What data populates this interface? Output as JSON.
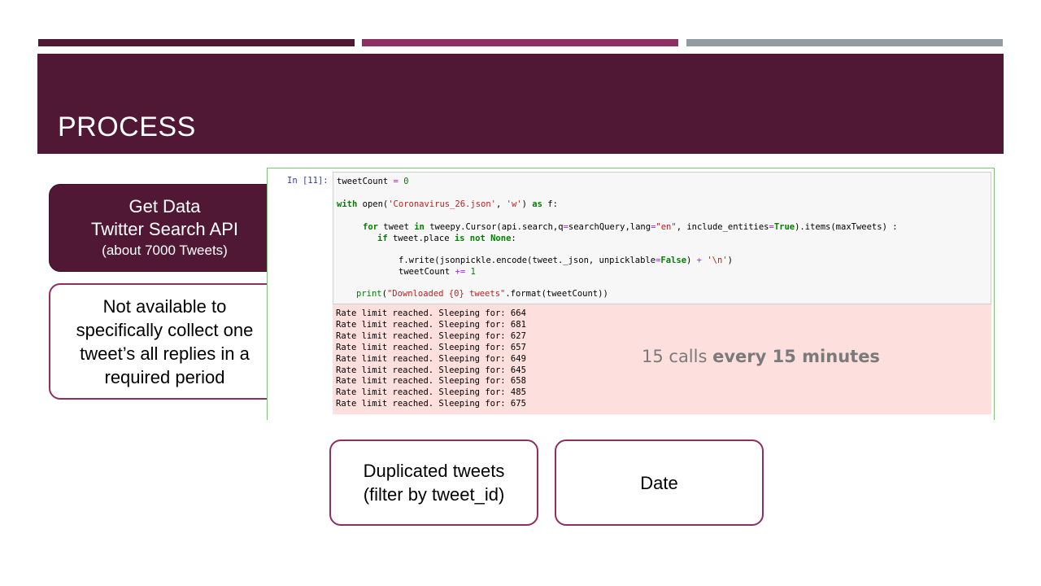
{
  "slide": {
    "title": "PROCESS",
    "colors": {
      "dark": "#511835",
      "mid": "#8e2e62",
      "grey": "#949ca3",
      "output_bg": "#fddfdd"
    }
  },
  "boxes": {
    "get_data": {
      "line1": "Get Data",
      "line2": "Twitter Search API",
      "line3": "(about 7000 Tweets)"
    },
    "not_available": {
      "line1": "Not available to",
      "line2": "specifically collect one",
      "line3": "tweet’s all  replies in a",
      "line4": "required period"
    },
    "duplicated": {
      "line1": "Duplicated tweets",
      "line2": "(filter by tweet_id)"
    },
    "date": {
      "line1": "Date"
    }
  },
  "notebook": {
    "prompt": "In [11]:",
    "code": {
      "l1_var": "tweetCount",
      "l1_op": " = ",
      "l1_num": "0",
      "l2_kw1": "with",
      "l2_a": " open(",
      "l2_str1": "'Coronavirus_26.json'",
      "l2_b": ", ",
      "l2_str2": "'w'",
      "l2_c": ") ",
      "l2_kw2": "as",
      "l2_d": " f:",
      "l3_kw1": "for",
      "l3_a": " tweet ",
      "l3_kw2": "in",
      "l3_b": " tweepy.Cursor(api.search,q",
      "l3_op1": "=",
      "l3_c": "searchQuery,lang",
      "l3_op2": "=",
      "l3_str": "\"en\"",
      "l3_d": ", include_entities",
      "l3_op3": "=",
      "l3_kw3": "True",
      "l3_e": ").items(maxTweets) :",
      "l4_kw1": "if",
      "l4_a": " tweet.place ",
      "l4_kw2": "is not",
      "l4_b": " ",
      "l4_kw3": "None",
      "l4_c": ":",
      "l5_a": "f.write(jsonpickle.encode(tweet._json, unpicklable",
      "l5_op1": "=",
      "l5_kw": "False",
      "l5_b": ") ",
      "l5_op2": "+",
      "l5_c": " ",
      "l5_str": "'\\n'",
      "l5_d": ")",
      "l6_a": "tweetCount ",
      "l6_op": "+=",
      "l6_b": " ",
      "l6_num": "1",
      "l7_kw": "print",
      "l7_a": "(",
      "l7_str": "\"Downloaded {0} tweets\"",
      "l7_b": ".format(tweetCount))"
    },
    "output_lines": [
      "Rate limit reached. Sleeping for: 664",
      "Rate limit reached. Sleeping for: 681",
      "Rate limit reached. Sleeping for: 627",
      "Rate limit reached. Sleeping for: 657",
      "Rate limit reached. Sleeping for: 649",
      "Rate limit reached. Sleeping for: 645",
      "Rate limit reached. Sleeping for: 658",
      "Rate limit reached. Sleeping for: 485",
      "Rate limit reached. Sleeping for: 675"
    ],
    "note_regular": "15 calls ",
    "note_bold": "every 15 minutes"
  }
}
